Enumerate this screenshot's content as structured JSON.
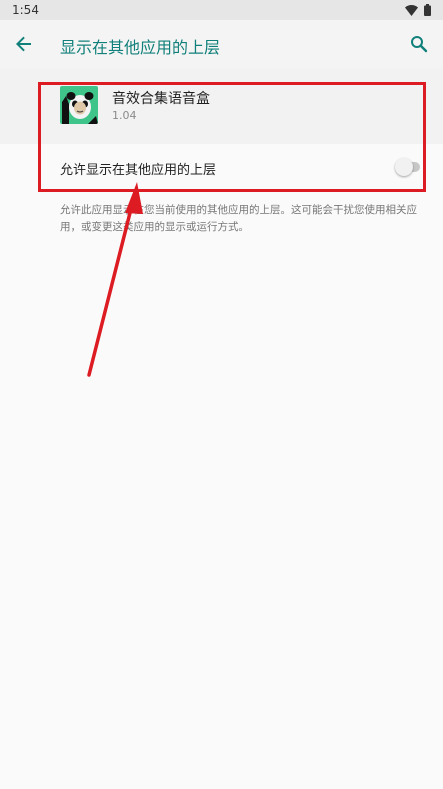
{
  "status": {
    "time": "1:54"
  },
  "app_bar": {
    "title": "显示在其他应用的上层"
  },
  "app": {
    "name": "音效合集语音盒",
    "version": "1.04"
  },
  "permission": {
    "label": "允许显示在其他应用的上层",
    "enabled": false
  },
  "description": "允许此应用显示在您当前使用的其他应用的上层。这可能会干扰您使用相关应用，或变更这类应用的显示或运行方式。",
  "icons": {
    "back": "arrow-back-icon",
    "search": "search-icon",
    "wifi": "wifi-icon",
    "battery": "battery-icon",
    "app": "panda-meme-icon"
  },
  "colors": {
    "accent": "#11807a",
    "annotation": "#dd1b22"
  }
}
